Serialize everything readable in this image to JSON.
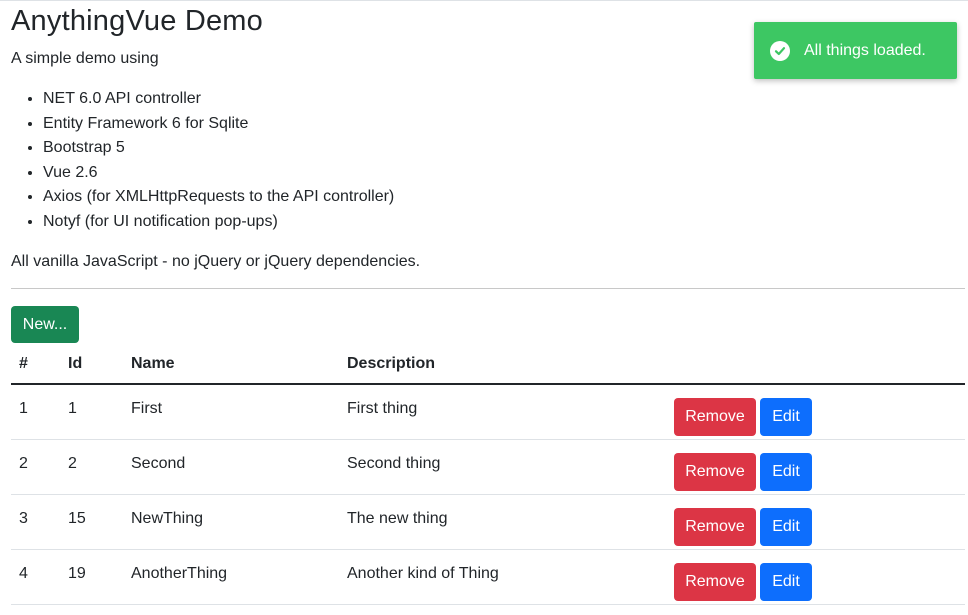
{
  "page": {
    "title": "AnythingVue Demo",
    "intro": "A simple demo using",
    "techs": [
      "NET 6.0 API controller",
      "Entity Framework 6 for Sqlite",
      "Bootstrap 5",
      "Vue 2.6",
      "Axios (for XMLHttpRequests to the API controller)",
      "Notyf (for UI notification pop-ups)"
    ],
    "vanilla": "All vanilla JavaScript - no jQuery or jQuery dependencies."
  },
  "toolbar": {
    "new_label": "New..."
  },
  "table": {
    "headers": [
      "#",
      "Id",
      "Name",
      "Description",
      ""
    ],
    "remove_label": "Remove",
    "edit_label": "Edit",
    "rows": [
      {
        "num": "1",
        "id": "1",
        "name": "First",
        "description": "First thing"
      },
      {
        "num": "2",
        "id": "2",
        "name": "Second",
        "description": "Second thing"
      },
      {
        "num": "3",
        "id": "15",
        "name": "NewThing",
        "description": "The new thing"
      },
      {
        "num": "4",
        "id": "19",
        "name": "AnotherThing",
        "description": "Another kind of Thing"
      }
    ]
  },
  "toast": {
    "message": "All things loaded.",
    "icon": "check-circle-icon",
    "color": "#3dc763"
  },
  "colors": {
    "success": "#198754",
    "danger": "#dc3545",
    "primary": "#0d6efd"
  }
}
